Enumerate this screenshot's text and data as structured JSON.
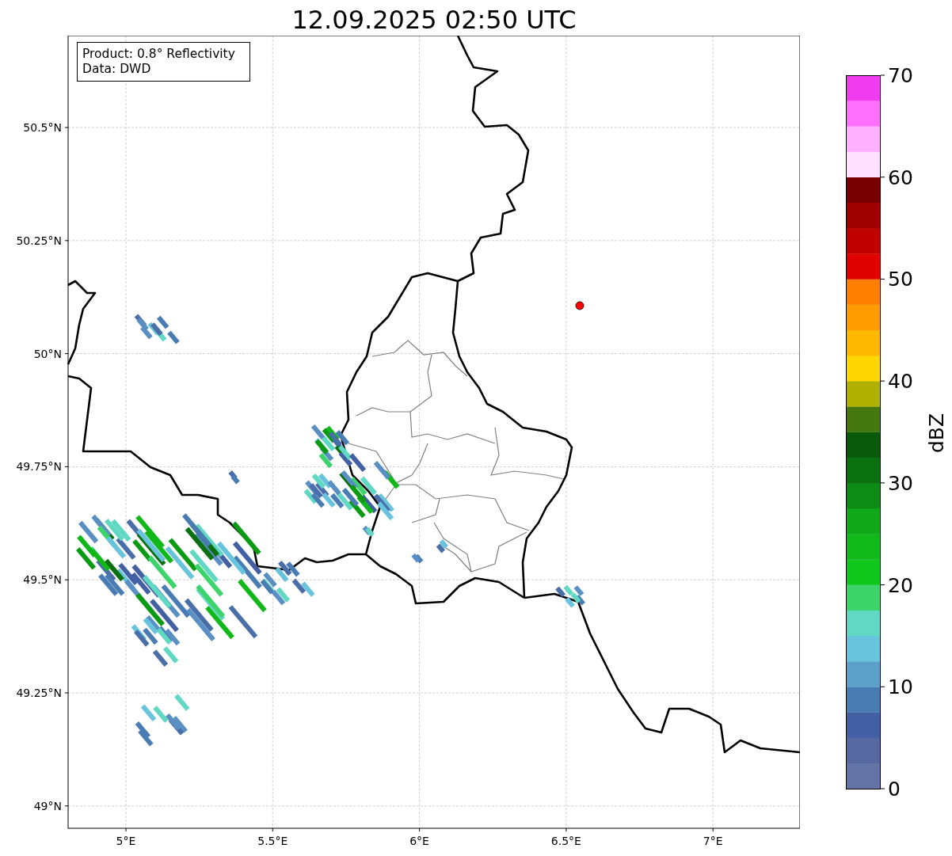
{
  "title": "12.09.2025 02:50 UTC",
  "info_box": {
    "lines": [
      "Product: 0.8° Reflectivity",
      "Data: DWD"
    ]
  },
  "map": {
    "x_ticks": [
      "5°E",
      "5.5°E",
      "6°E",
      "6.5°E",
      "7°E"
    ],
    "y_ticks": [
      "50.5°N",
      "50.25°N",
      "50°N",
      "49.75°N",
      "49.5°N",
      "49.25°N",
      "49°N"
    ]
  },
  "colorbar": {
    "label": "dBZ",
    "ticks": [
      "70",
      "60",
      "50",
      "40",
      "30",
      "20",
      "10",
      "0"
    ],
    "bins": [
      {
        "color": "#6473a6"
      },
      {
        "color": "#5668a0"
      },
      {
        "color": "#4460a4"
      },
      {
        "color": "#4a7cb4"
      },
      {
        "color": "#5aa0c8"
      },
      {
        "color": "#68c4dc"
      },
      {
        "color": "#60d8c4"
      },
      {
        "color": "#3ed46c"
      },
      {
        "color": "#10c81c"
      },
      {
        "color": "#10b81a"
      },
      {
        "color": "#10a818"
      },
      {
        "color": "#0c8c14"
      },
      {
        "color": "#0a7010"
      },
      {
        "color": "#085a0a"
      },
      {
        "color": "#467810"
      },
      {
        "color": "#b0b000"
      },
      {
        "color": "#ffd700"
      },
      {
        "color": "#ffb800"
      },
      {
        "color": "#ff9c00"
      },
      {
        "color": "#ff8000"
      },
      {
        "color": "#e00000"
      },
      {
        "color": "#c00000"
      },
      {
        "color": "#a00000"
      },
      {
        "color": "#780000"
      },
      {
        "color": "#ffe0ff"
      },
      {
        "color": "#ffb0ff"
      },
      {
        "color": "#ff70ff"
      },
      {
        "color": "#ee3cee"
      }
    ]
  }
}
